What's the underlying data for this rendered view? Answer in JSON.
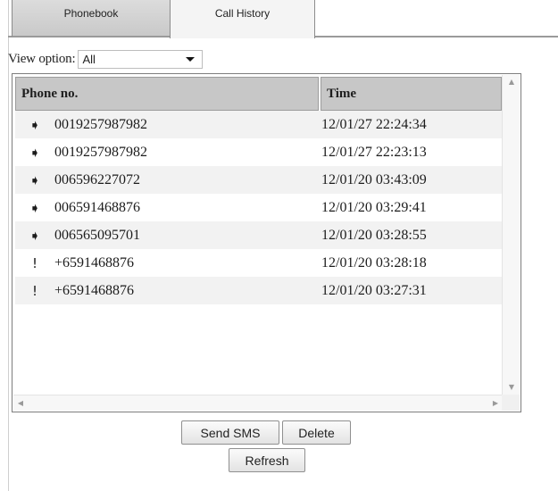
{
  "tabs": [
    {
      "label": "Phonebook",
      "selected": false
    },
    {
      "label": "Call History",
      "selected": true
    }
  ],
  "view_option": {
    "label": "View option:",
    "selected": "All"
  },
  "table": {
    "columns": [
      "Phone no.",
      "Time"
    ],
    "rows": [
      {
        "icon": "outgoing-call-icon",
        "glyph": "➧",
        "phone": "0019257987982",
        "time": "12/01/27 22:24:34"
      },
      {
        "icon": "outgoing-call-icon",
        "glyph": "➧",
        "phone": "0019257987982",
        "time": "12/01/27 22:23:13"
      },
      {
        "icon": "outgoing-call-icon",
        "glyph": "➧",
        "phone": "006596227072",
        "time": "12/01/20 03:43:09"
      },
      {
        "icon": "outgoing-call-icon",
        "glyph": "➧",
        "phone": "006591468876",
        "time": "12/01/20 03:29:41"
      },
      {
        "icon": "outgoing-call-icon",
        "glyph": "➧",
        "phone": "006565095701",
        "time": "12/01/20 03:28:55"
      },
      {
        "icon": "missed-call-icon",
        "glyph": "!",
        "phone": "+6591468876",
        "time": "12/01/20 03:28:18"
      },
      {
        "icon": "missed-call-icon",
        "glyph": "!",
        "phone": "+6591468876",
        "time": "12/01/20 03:27:31"
      }
    ]
  },
  "buttons": {
    "send_sms": "Send SMS",
    "delete": "Delete",
    "refresh": "Refresh"
  }
}
